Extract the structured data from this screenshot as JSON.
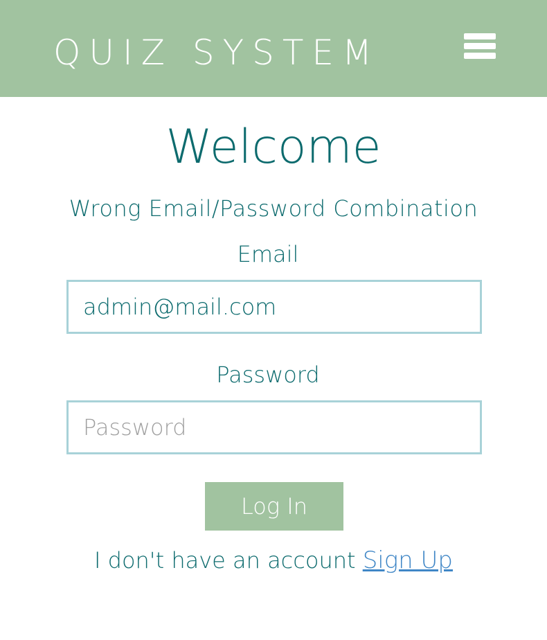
{
  "header": {
    "brand": "QUIZ SYSTEM",
    "menu_icon": "hamburger-menu-icon",
    "background_color": "#a1c3a0"
  },
  "login": {
    "title": "Welcome",
    "error_message": "Wrong Email/Password Combination",
    "email_label": "Email",
    "email_value": "admin@mail.com",
    "password_label": "Password",
    "password_placeholder": "Password",
    "submit_label": "Log In",
    "signup_prompt": "I don't have an account",
    "signup_link": "Sign Up"
  },
  "colors": {
    "accent": "#a1c3a0",
    "text": "#0d6b6e",
    "input_border": "#a8d2d8",
    "link": "#3f86c6"
  }
}
